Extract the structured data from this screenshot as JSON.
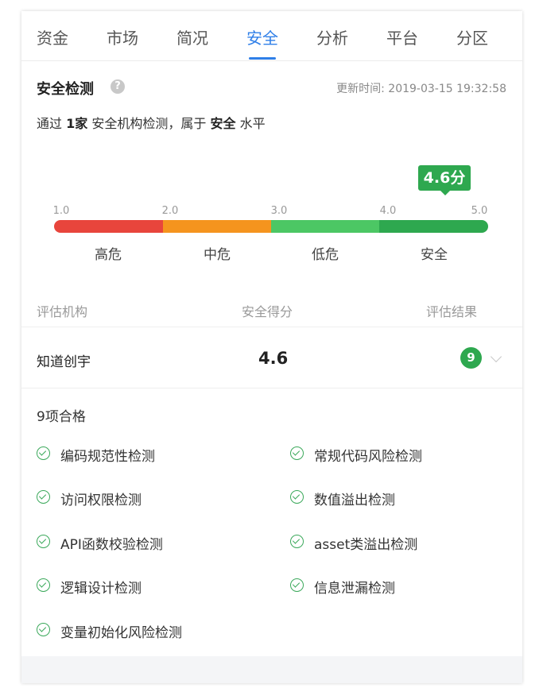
{
  "tabs": [
    {
      "label": "资金"
    },
    {
      "label": "市场"
    },
    {
      "label": "简况"
    },
    {
      "label": "安全",
      "active": true
    },
    {
      "label": "分析"
    },
    {
      "label": "平台"
    },
    {
      "label": "分区"
    }
  ],
  "section": {
    "title": "安全检测",
    "help_icon": "help-circle-icon",
    "update_time": "更新时间: 2019-03-15 19:32:58",
    "summary_prefix": "通过",
    "summary_count": "1家",
    "summary_mid": "安全机构检测，属于",
    "summary_level": "安全",
    "summary_suffix": "水平"
  },
  "scale": {
    "ticks": [
      "1.0",
      "2.0",
      "3.0",
      "4.0",
      "5.0"
    ],
    "segments": [
      {
        "label": "高危",
        "color": "#e8453c"
      },
      {
        "label": "中危",
        "color": "#f5941e"
      },
      {
        "label": "低危",
        "color": "#4cc764"
      },
      {
        "label": "安全",
        "color": "#2ea84f"
      }
    ],
    "score": 4.6,
    "score_label": "4.6分",
    "min": 1.0,
    "max": 5.0
  },
  "table": {
    "headers": [
      "评估机构",
      "安全得分",
      "评估结果"
    ],
    "row": {
      "org": "知道创宇",
      "score": "4.6",
      "result_count": "9"
    }
  },
  "passed": {
    "title": "9项合格",
    "items": [
      "编码规范性检测",
      "常规代码风险检测",
      "访问权限检测",
      "数值溢出检测",
      "API函数校验检测",
      "asset类溢出检测",
      "逻辑设计检测",
      "信息泄漏检测",
      "变量初始化风险检测"
    ]
  },
  "colors": {
    "accent": "#2f7fe8",
    "safe_green": "#2ea84f"
  }
}
